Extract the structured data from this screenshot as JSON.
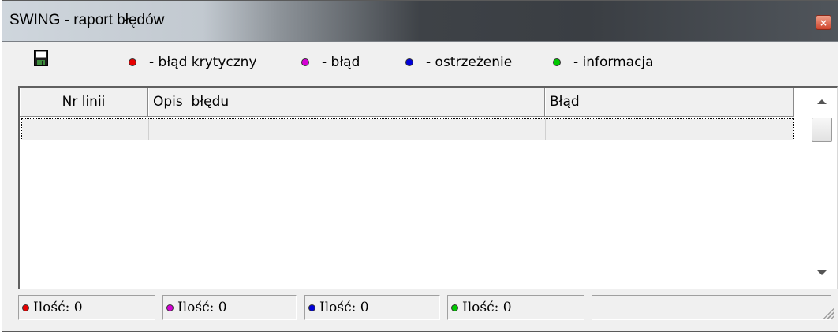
{
  "window": {
    "title": "SWING - raport błędów",
    "close_label": "×"
  },
  "toolbar": {
    "save_icon": "floppy-disk-icon",
    "legend": [
      {
        "color": "#e60000",
        "label": "- błąd krytyczny"
      },
      {
        "color": "#d400d4",
        "label": "- błąd"
      },
      {
        "color": "#0000d8",
        "label": "- ostrzeżenie"
      },
      {
        "color": "#00c800",
        "label": "- informacja"
      }
    ]
  },
  "grid": {
    "columns": [
      "Nr linii",
      "Opis  błędu",
      "Błąd"
    ],
    "rows": [
      [
        "",
        "",
        ""
      ]
    ]
  },
  "statusbar": {
    "panels": [
      {
        "color": "#e60000",
        "text": "Ilość: 0"
      },
      {
        "color": "#d400d4",
        "text": "Ilość: 0"
      },
      {
        "color": "#0000d8",
        "text": "Ilość: 0"
      },
      {
        "color": "#00c800",
        "text": "Ilość: 0"
      }
    ],
    "extra_panel_text": ""
  }
}
